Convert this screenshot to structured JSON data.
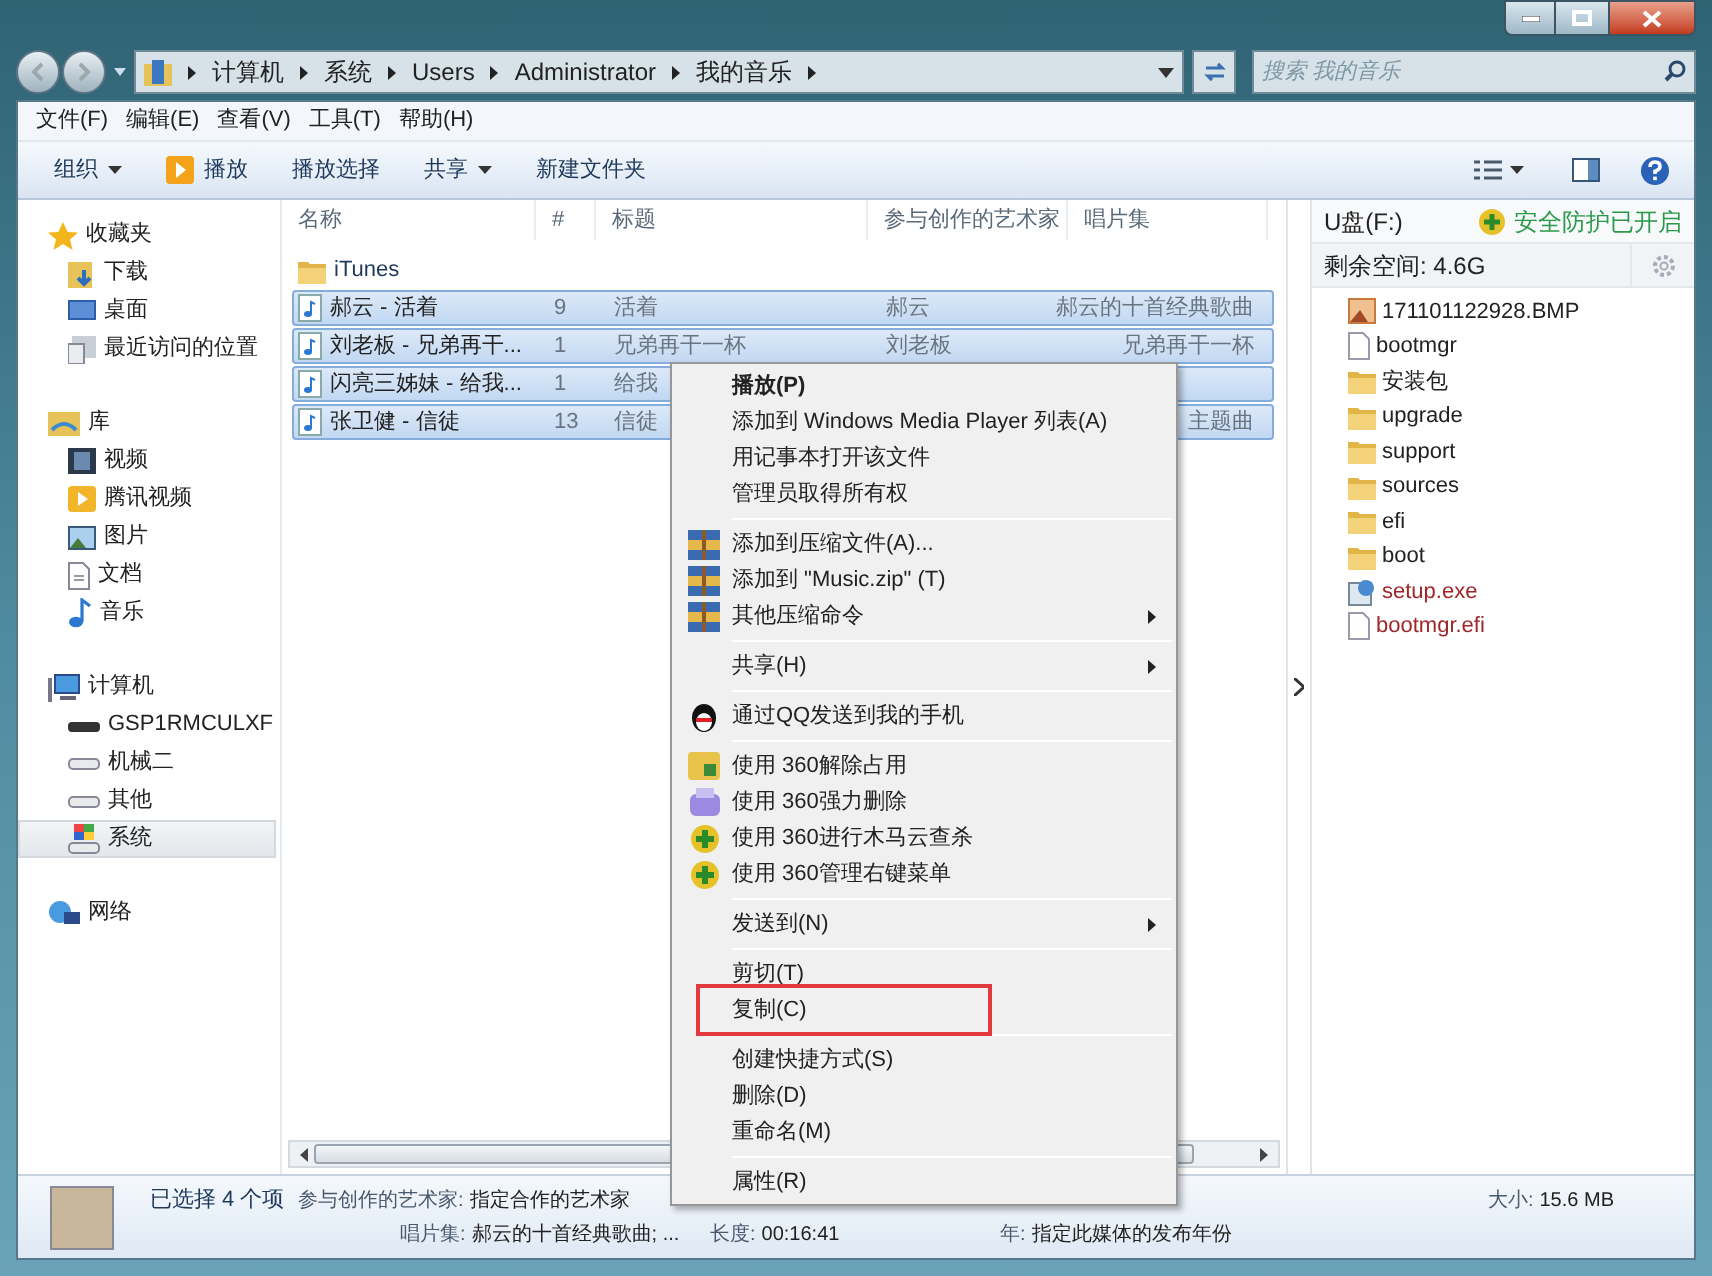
{
  "address_bar": {
    "crumbs": [
      "计算机",
      "系统",
      "Users",
      "Administrator",
      "我的音乐"
    ]
  },
  "search": {
    "placeholder": "搜索 我的音乐"
  },
  "menu_bar": [
    "文件(F)",
    "编辑(E)",
    "查看(V)",
    "工具(T)",
    "帮助(H)"
  ],
  "toolbar": [
    {
      "label": "组织",
      "kind": "dropdown"
    },
    {
      "label": "播放",
      "kind": "play"
    },
    {
      "label": "播放选择",
      "kind": "plain"
    },
    {
      "label": "共享",
      "kind": "dropdown"
    },
    {
      "label": "新建文件夹",
      "kind": "plain"
    }
  ],
  "nav_pane": [
    {
      "label": "收藏夹",
      "selected": false,
      "children": [
        {
          "label": "下载",
          "selected": false
        },
        {
          "label": "桌面",
          "selected": false
        },
        {
          "label": "最近访问的位置",
          "selected": false
        }
      ]
    },
    {
      "label": "库",
      "selected": false,
      "children": [
        {
          "label": "视频",
          "selected": false
        },
        {
          "label": "腾讯视频",
          "selected": false
        },
        {
          "label": "图片",
          "selected": false
        },
        {
          "label": "文档",
          "selected": false
        },
        {
          "label": "音乐",
          "selected": false
        }
      ]
    },
    {
      "label": "计算机",
      "selected": false,
      "children": [
        {
          "label": "GSP1RMCULXF",
          "selected": false
        },
        {
          "label": "机械二",
          "selected": false
        },
        {
          "label": "其他",
          "selected": false
        },
        {
          "label": "系统",
          "selected": true
        }
      ]
    },
    {
      "label": "网络",
      "selected": false
    }
  ],
  "file_list": {
    "columns": [
      "名称",
      "#",
      "标题",
      "参与创作的艺术家",
      "唱片集"
    ],
    "rows": [
      {
        "kind": "folder",
        "selected": false,
        "cells": [
          "iTunes",
          "",
          "",
          "",
          ""
        ]
      },
      {
        "kind": "music",
        "selected": true,
        "cells": [
          "郝云 - 活着",
          "9",
          "活着",
          "郝云",
          "郝云的十首经典歌曲"
        ]
      },
      {
        "kind": "music",
        "selected": true,
        "cells": [
          "刘老板 - 兄弟再干...",
          "1",
          "兄弟再干一杯",
          "刘老板",
          "兄弟再干一杯"
        ]
      },
      {
        "kind": "music",
        "selected": true,
        "cells": [
          "闪亮三姊妹 - 给我...",
          "1",
          "给我",
          "",
          ""
        ]
      },
      {
        "kind": "music",
        "selected": true,
        "cells": [
          "张卫健 - 信徒",
          "13",
          "信徒",
          "",
          "主题曲"
        ]
      }
    ]
  },
  "usb_pane": {
    "title": "U盘(F:)",
    "protection": "安全防护已开启",
    "free_space": "剩余空间: 4.6G",
    "files": [
      {
        "name": "171101122928.BMP",
        "kind": "image",
        "color": "#222222"
      },
      {
        "name": "bootmgr",
        "kind": "file",
        "color": "#222222"
      },
      {
        "name": "安装包",
        "kind": "folder",
        "color": "#222222"
      },
      {
        "name": "upgrade",
        "kind": "folder",
        "color": "#222222"
      },
      {
        "name": "support",
        "kind": "folder",
        "color": "#222222"
      },
      {
        "name": "sources",
        "kind": "folder",
        "color": "#222222"
      },
      {
        "name": "efi",
        "kind": "folder",
        "color": "#222222"
      },
      {
        "name": "boot",
        "kind": "folder",
        "color": "#222222"
      },
      {
        "name": "setup.exe",
        "kind": "exe",
        "color": "#a0262a"
      },
      {
        "name": "bootmgr.efi",
        "kind": "file",
        "color": "#a0262a"
      }
    ]
  },
  "context_menu": [
    [
      {
        "label": "播放(P)",
        "bold": true,
        "submenu": false,
        "highlighted": false
      },
      {
        "label": "添加到 Windows Media Player 列表(A)",
        "bold": false,
        "submenu": false,
        "highlighted": false
      },
      {
        "label": "用记事本打开该文件",
        "bold": false,
        "submenu": false,
        "highlighted": false
      },
      {
        "label": "管理员取得所有权",
        "bold": false,
        "submenu": false,
        "highlighted": false
      }
    ],
    [
      {
        "label": "添加到压缩文件(A)...",
        "bold": false,
        "submenu": false,
        "highlighted": false
      },
      {
        "label": "添加到 \"Music.zip\" (T)",
        "bold": false,
        "submenu": false,
        "highlighted": false
      },
      {
        "label": "其他压缩命令",
        "bold": false,
        "submenu": true,
        "highlighted": false
      }
    ],
    [
      {
        "label": "共享(H)",
        "bold": false,
        "submenu": true,
        "highlighted": false
      }
    ],
    [
      {
        "label": "通过QQ发送到我的手机",
        "bold": false,
        "submenu": false,
        "highlighted": false
      }
    ],
    [
      {
        "label": "使用 360解除占用",
        "bold": false,
        "submenu": false,
        "highlighted": false
      },
      {
        "label": "使用 360强力删除",
        "bold": false,
        "submenu": false,
        "highlighted": false
      },
      {
        "label": "使用 360进行木马云查杀",
        "bold": false,
        "submenu": false,
        "highlighted": false
      },
      {
        "label": "使用 360管理右键菜单",
        "bold": false,
        "submenu": false,
        "highlighted": false
      }
    ],
    [
      {
        "label": "发送到(N)",
        "bold": false,
        "submenu": true,
        "highlighted": false
      }
    ],
    [
      {
        "label": "剪切(T)",
        "bold": false,
        "submenu": false,
        "highlighted": false
      },
      {
        "label": "复制(C)",
        "bold": false,
        "submenu": false,
        "highlighted": true
      }
    ],
    [
      {
        "label": "创建快捷方式(S)",
        "bold": false,
        "submenu": false,
        "highlighted": false
      },
      {
        "label": "删除(D)",
        "bold": false,
        "submenu": false,
        "highlighted": false
      },
      {
        "label": "重命名(M)",
        "bold": false,
        "submenu": false,
        "highlighted": false
      }
    ],
    [
      {
        "label": "属性(R)",
        "bold": false,
        "submenu": false,
        "highlighted": false
      }
    ]
  ],
  "status_bar": {
    "selection": "已选择 4 个项",
    "rows": [
      [
        {
          "label": "参与创作的艺术家:",
          "value": "指定合作的艺术家"
        },
        {
          "label": "大小:",
          "value": "15.6 MB"
        }
      ],
      [
        {
          "label": "唱片集:",
          "value": "郝云的十首经典歌曲; ..."
        },
        {
          "label": "长度:",
          "value": "00:16:41"
        },
        {
          "label": "年:",
          "value": "指定此媒体的发布年份"
        }
      ]
    ]
  }
}
